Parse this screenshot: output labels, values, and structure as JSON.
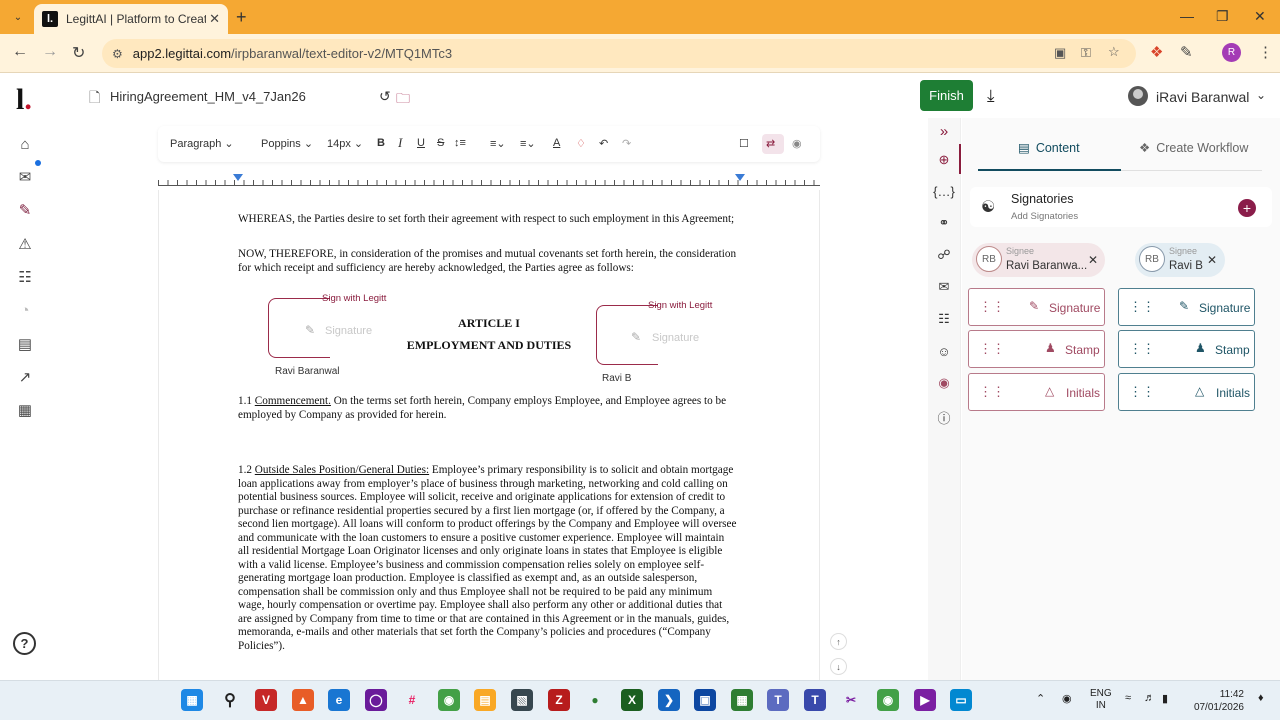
{
  "browser": {
    "tab_title": "LegittAI | Platform to Create &",
    "tab_favicon": "l.",
    "new_tab_icon": "+",
    "url_host": "app2.legittai.com",
    "url_path": "/irpbaranwal/text-editor-v2/MTQ1MTc3",
    "profile_initial": "R"
  },
  "app": {
    "brand": "l",
    "brand_dot": ".",
    "doc_title": "HiringAgreement_HM_v4_7Jan26",
    "finish_label": "Finish",
    "user_name": "iRavi Baranwal"
  },
  "toolbar": {
    "paragraph": "Paragraph",
    "font": "Poppins",
    "size": "14px",
    "bold": "B",
    "italic": "I",
    "underline": "U",
    "strike": "S"
  },
  "document": {
    "p_whereas": "WHEREAS, the Parties desire to set forth their agreement with respect to such employment in this Agreement;",
    "p_now": "NOW, THEREFORE, in consideration of the promises and mutual covenants set forth herein, the consideration for which receipt and sufficiency are hereby acknowledged, the Parties agree as follows:",
    "article_title": "ARTICLE I",
    "article_subtitle": "EMPLOYMENT AND DUTIES",
    "sign_with_legitt": "Sign with Legitt",
    "signature_placeholder": "Signature",
    "sig1_name": "Ravi Baranwal",
    "sig2_name": "Ravi B",
    "s11_num": "1.1 ",
    "s11_heading": "Commencement.",
    "s11_body": " On the terms set forth herein, Company employs Employee, and Employee agrees to be employed by Company as provided for herein.",
    "s12_num": "1.2 ",
    "s12_heading": "Outside Sales Position/General Duties:",
    "s12_body": " Employee’s primary responsibility is to solicit and obtain mortgage loan applications away from employer’s place of business through marketing, networking and cold calling on potential business sources. Employee will solicit, receive and originate applications for extension of credit to purchase or refinance residential properties secured by a first lien mortgage (or, if offered by the Company, a second lien mortgage). All loans will conform to product offerings by the Company and Employee will oversee and communicate with the loan customers to ensure a positive customer experience. Employee will maintain all residential Mortgage Loan Originator licenses and only originate loans in states that Employee is eligible with a valid license. Employee’s business and commission compensation relies solely on employee self-generating mortgage loan production. Employee is classified as exempt and, as an outside salesperson, compensation shall be commission only and thus Employee shall not be required to be paid any minimum wage, hourly compensation or overtime pay. Employee shall also perform any other or additional duties that are assigned by Company from time to time or that are contained in this Agreement or in the manuals, guides, memoranda, e-mails and other materials that set forth the Company’s policies and procedures (“Company Policies”)."
  },
  "panel": {
    "tab_content": "Content",
    "tab_workflow": "Create Workflow",
    "signatories_title": "Signatories",
    "signatories_sub": "Add Signatories",
    "signee_label": "Signee",
    "signee1_initials": "RB",
    "signee1_name": "Ravi Baranwa...",
    "signee2_initials": "RB",
    "signee2_name": "Ravi B",
    "field_signature": "Signature",
    "field_stamp": "Stamp",
    "field_initials": "Initials",
    "accent_color": "#1e7e34",
    "brand_color": "#8a1d4a"
  },
  "taskbar": {
    "lang_line1": "ENG",
    "lang_line2": "IN",
    "time": "11:42",
    "date": "07/01/2026"
  }
}
